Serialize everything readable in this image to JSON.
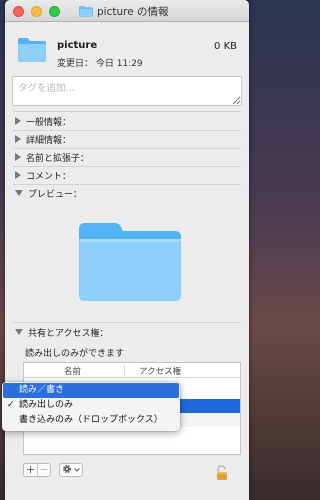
{
  "window": {
    "title": "picture の情報"
  },
  "header": {
    "name": "picture",
    "size": "0 KB",
    "modified": "変更日：  今日 11:29"
  },
  "tags": {
    "placeholder": "タグを追加..."
  },
  "sections": {
    "general": "一般情報：",
    "more_info": "詳細情報：",
    "name_ext": "名前と拡張子：",
    "comments": "コメント：",
    "preview": "プレビュー：",
    "sharing": "共有とアクセス権："
  },
  "sharing": {
    "description": "読み出しのみができます",
    "columns": [
      "名前",
      "アクセス権"
    ]
  },
  "popup_menu": {
    "items": [
      {
        "label": "読み／書き",
        "checked": false,
        "highlighted": true
      },
      {
        "label": "読み出しのみ",
        "checked": true,
        "highlighted": false
      },
      {
        "label": "書き込みのみ（ドロップボックス）",
        "checked": false,
        "highlighted": false
      }
    ],
    "check_mark": "✓"
  },
  "toolbar": {
    "add": "+",
    "remove": "−"
  },
  "colors": {
    "folder_light": "#8fd0fb",
    "folder_dark": "#54b3f3",
    "selection": "#1e6ad9"
  },
  "icons": [
    "folder-icon",
    "gear-icon",
    "lock-icon"
  ]
}
